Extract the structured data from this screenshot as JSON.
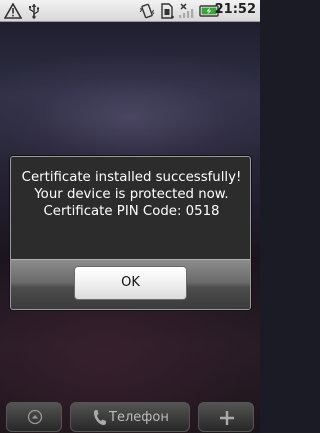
{
  "status_bar": {
    "time": "21:52",
    "icons": [
      "warning-icon",
      "usb-icon",
      "vibrate-icon",
      "sim-icon",
      "no-signal-icon",
      "battery-charging-icon"
    ],
    "battery_color": "#3aa53a"
  },
  "dialog": {
    "message_lines": [
      "Certificate installed successfully!",
      "Your device is protected now.",
      "Certificate PIN Code: 0518"
    ],
    "ok_label": "OK"
  },
  "dock": {
    "phone_label": "Телефон",
    "icons": [
      "apps-up-icon",
      "phone-icon",
      "add-icon"
    ]
  }
}
